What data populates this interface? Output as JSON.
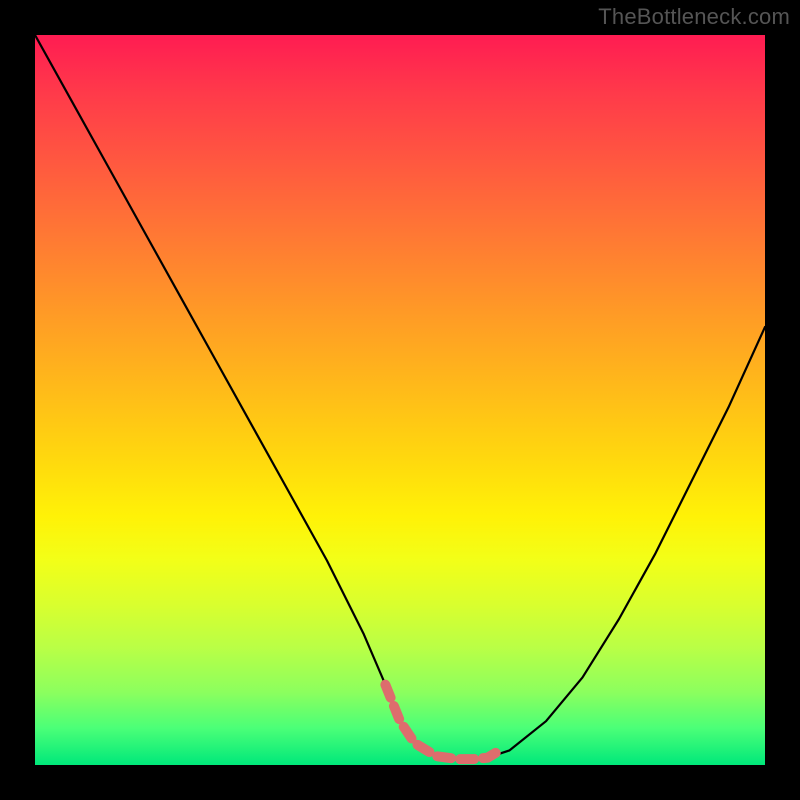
{
  "watermark": "TheBottleneck.com",
  "colors": {
    "page_bg": "#000000",
    "curve_stroke": "#000000",
    "highlight_stroke": "#dd6d6d",
    "watermark_text": "#555555",
    "gradient_top": "#ff1c52",
    "gradient_bottom": "#00e87a"
  },
  "chart_data": {
    "type": "line",
    "title": "",
    "xlabel": "",
    "ylabel": "",
    "xlim": [
      0,
      100
    ],
    "ylim": [
      0,
      100
    ],
    "grid": false,
    "series": [
      {
        "name": "curve",
        "x": [
          0,
          5,
          10,
          15,
          20,
          25,
          30,
          35,
          40,
          45,
          48,
          50,
          52,
          55,
          58,
          60,
          62,
          65,
          70,
          75,
          80,
          85,
          90,
          95,
          100
        ],
        "y": [
          100,
          91,
          82,
          73,
          64,
          55,
          46,
          37,
          28,
          18,
          11,
          6,
          3,
          1.2,
          0.8,
          0.8,
          1.0,
          2,
          6,
          12,
          20,
          29,
          39,
          49,
          60
        ]
      },
      {
        "name": "highlight-bottom",
        "x": [
          48,
          50,
          52,
          55,
          58,
          60,
          62,
          64
        ],
        "y": [
          11,
          6,
          3,
          1.2,
          0.8,
          0.8,
          1.0,
          2.2
        ]
      }
    ],
    "annotations": []
  }
}
